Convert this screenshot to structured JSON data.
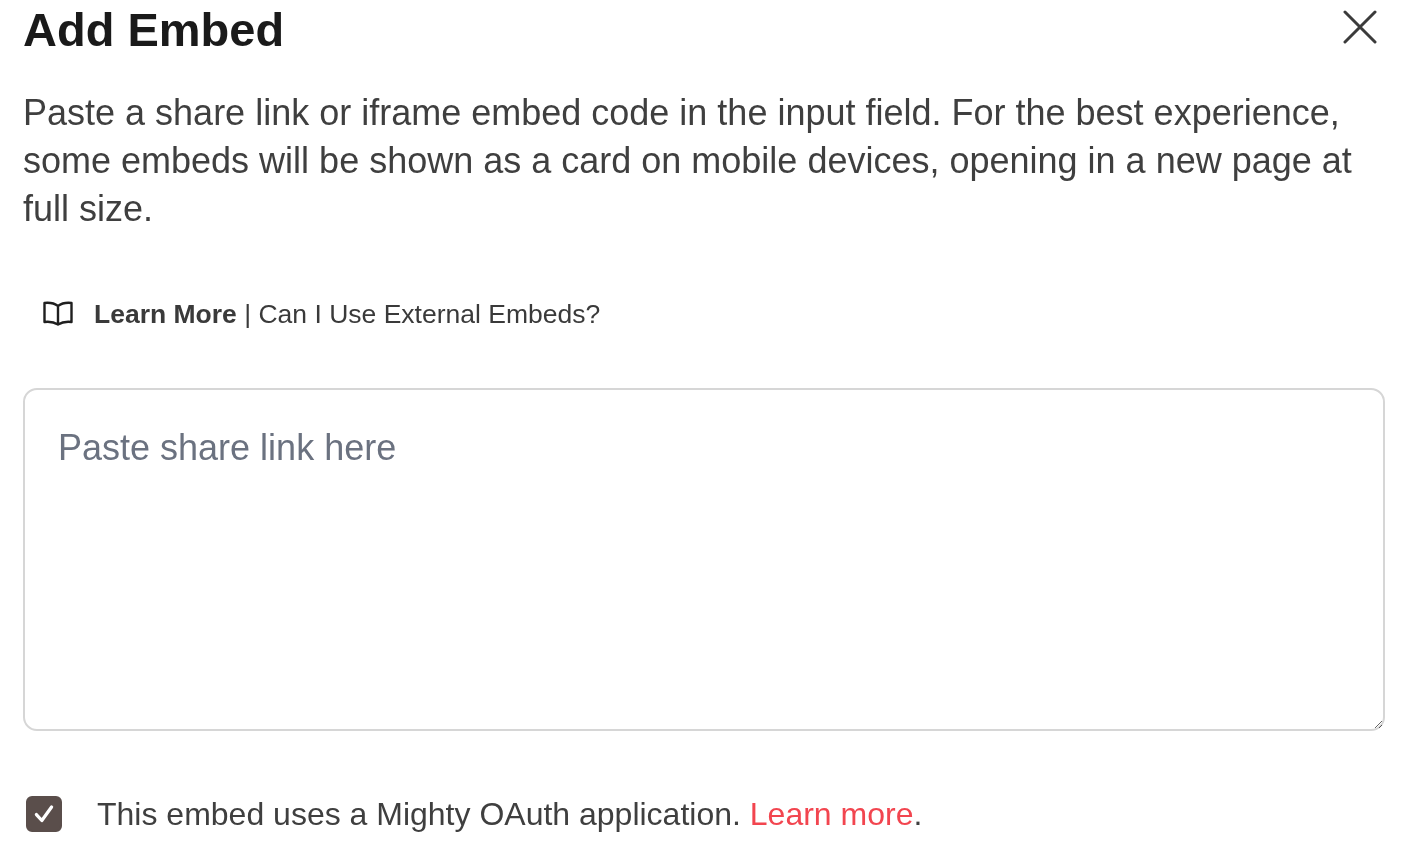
{
  "dialog": {
    "title": "Add Embed",
    "description": "Paste a share link or iframe embed code in the input field. For the best experience, some embeds will be shown as a card on mobile devices, opening in a new page at full size.",
    "help_link": {
      "text": "**Learn More** | Can I Use External Embeds?"
    },
    "embed_field": {
      "placeholder": "Paste share link here"
    },
    "oauth_option": {
      "checked": true,
      "text": "This embed uses a Mighty OAuth application. ",
      "link": "Learn more",
      "text_after": "."
    }
  }
}
